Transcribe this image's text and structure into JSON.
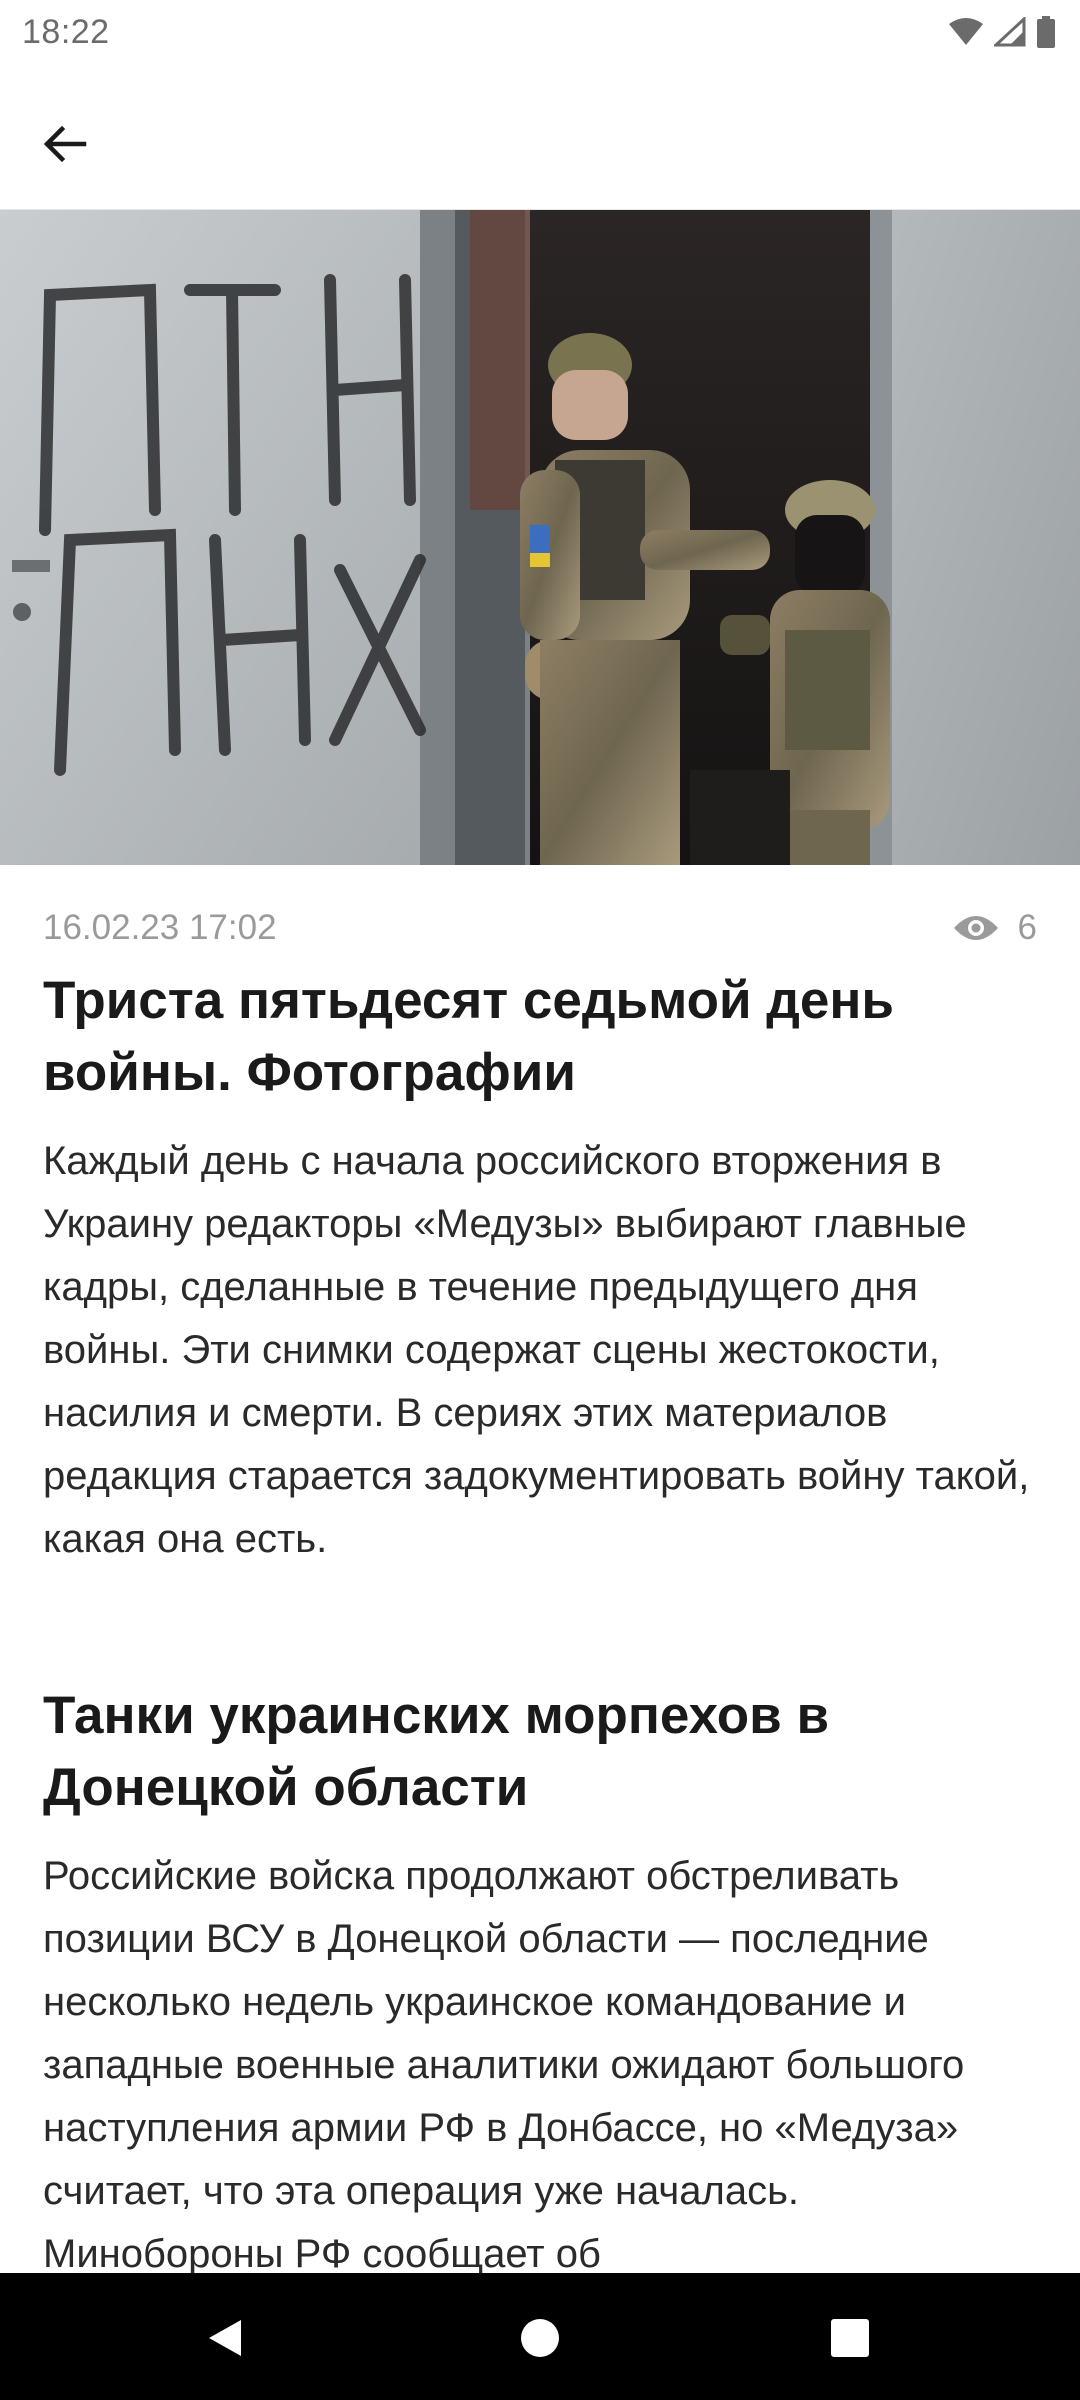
{
  "status_bar": {
    "time": "18:22"
  },
  "article": {
    "date": "16.02.23 17:02",
    "views": "6",
    "title": "Триста пятьдесят седьмой день войны. Фотографии",
    "lead": "Каждый день с начала российского вторжения в Украину редакторы «Медузы» выбирают главные кадры, сделанные в течение предыдущего дня войны. Эти снимки содержат сцены жестокости, насилия и смерти. В сериях этих материалов редакция старается задокументировать войну такой, какая она есть.",
    "section_title": "Танки украинских морпехов в Донецкой области",
    "section_text": "Российские войска продолжают обстреливать позиции ВСУ в Донецкой области — последние несколько недель украинское командование и западные военные аналитики ожидают большого наступления армии РФ в Донбассе, но «Медуза» считает, что эта операция уже началась. Минобороны РФ сообщает об",
    "image_graffiti_text": "ПТН ПНХ"
  },
  "icons": {
    "back": "arrow-left-icon",
    "views": "eye-icon",
    "wifi": "wifi-icon",
    "signal": "signal-icon",
    "battery": "battery-icon",
    "nav_back": "triangle-back-icon",
    "nav_home": "circle-home-icon",
    "nav_recents": "square-recents-icon"
  },
  "colors": {
    "meta_gray": "#9a9a9a",
    "text": "#1a1a1a",
    "nav_bar": "#000000"
  }
}
